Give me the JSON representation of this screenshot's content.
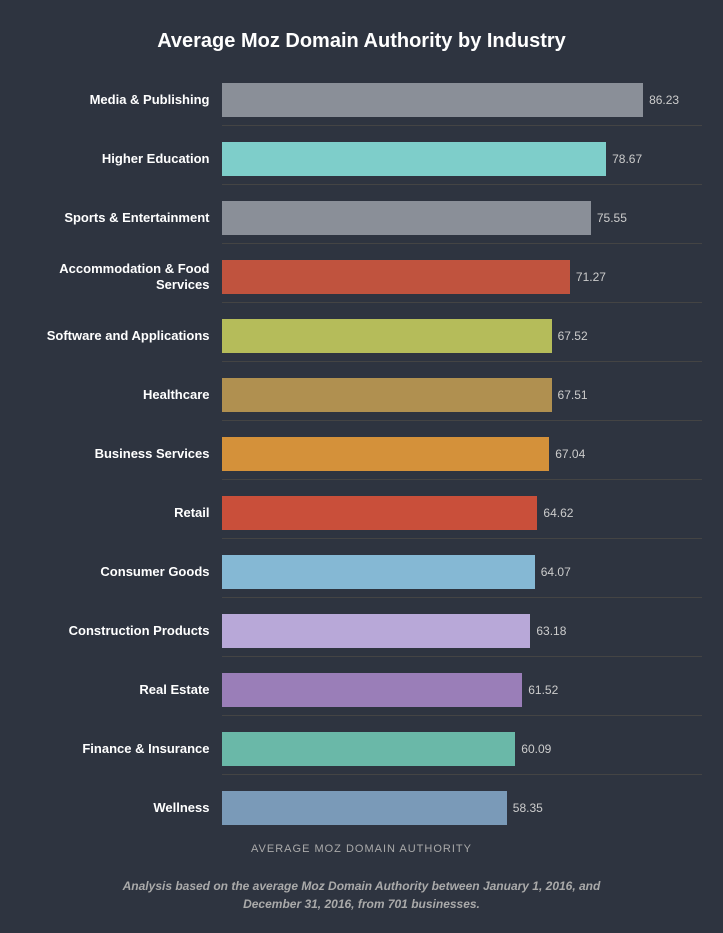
{
  "chart": {
    "title": "Average Moz Domain Authority by Industry",
    "x_axis_label": "AVERAGE MOZ DOMAIN AUTHORITY",
    "footnote": "Analysis based on the average Moz Domain Authority between January 1, 2016, and December 31, 2016, from 701 businesses.",
    "max_value": 90,
    "bars": [
      {
        "label": "Media & Publishing",
        "value": 86.23,
        "color": "#8a8f98"
      },
      {
        "label": "Higher Education",
        "value": 78.67,
        "color": "#7ececa"
      },
      {
        "label": "Sports & Entertainment",
        "value": 75.55,
        "color": "#8a8f98"
      },
      {
        "label": "Accommodation & Food Services",
        "value": 71.27,
        "color": "#c0533e"
      },
      {
        "label": "Software and Applications",
        "value": 67.52,
        "color": "#b5bc5a"
      },
      {
        "label": "Healthcare",
        "value": 67.51,
        "color": "#b09050"
      },
      {
        "label": "Business Services",
        "value": 67.04,
        "color": "#d4913a"
      },
      {
        "label": "Retail",
        "value": 64.62,
        "color": "#c94f3a"
      },
      {
        "label": "Consumer Goods",
        "value": 64.07,
        "color": "#85b8d4"
      },
      {
        "label": "Construction Products",
        "value": 63.18,
        "color": "#b8a8d8"
      },
      {
        "label": "Real Estate",
        "value": 61.52,
        "color": "#9a7eb8"
      },
      {
        "label": "Finance & Insurance",
        "value": 60.09,
        "color": "#6ab8a8"
      },
      {
        "label": "Wellness",
        "value": 58.35,
        "color": "#7a9ab8"
      }
    ]
  }
}
